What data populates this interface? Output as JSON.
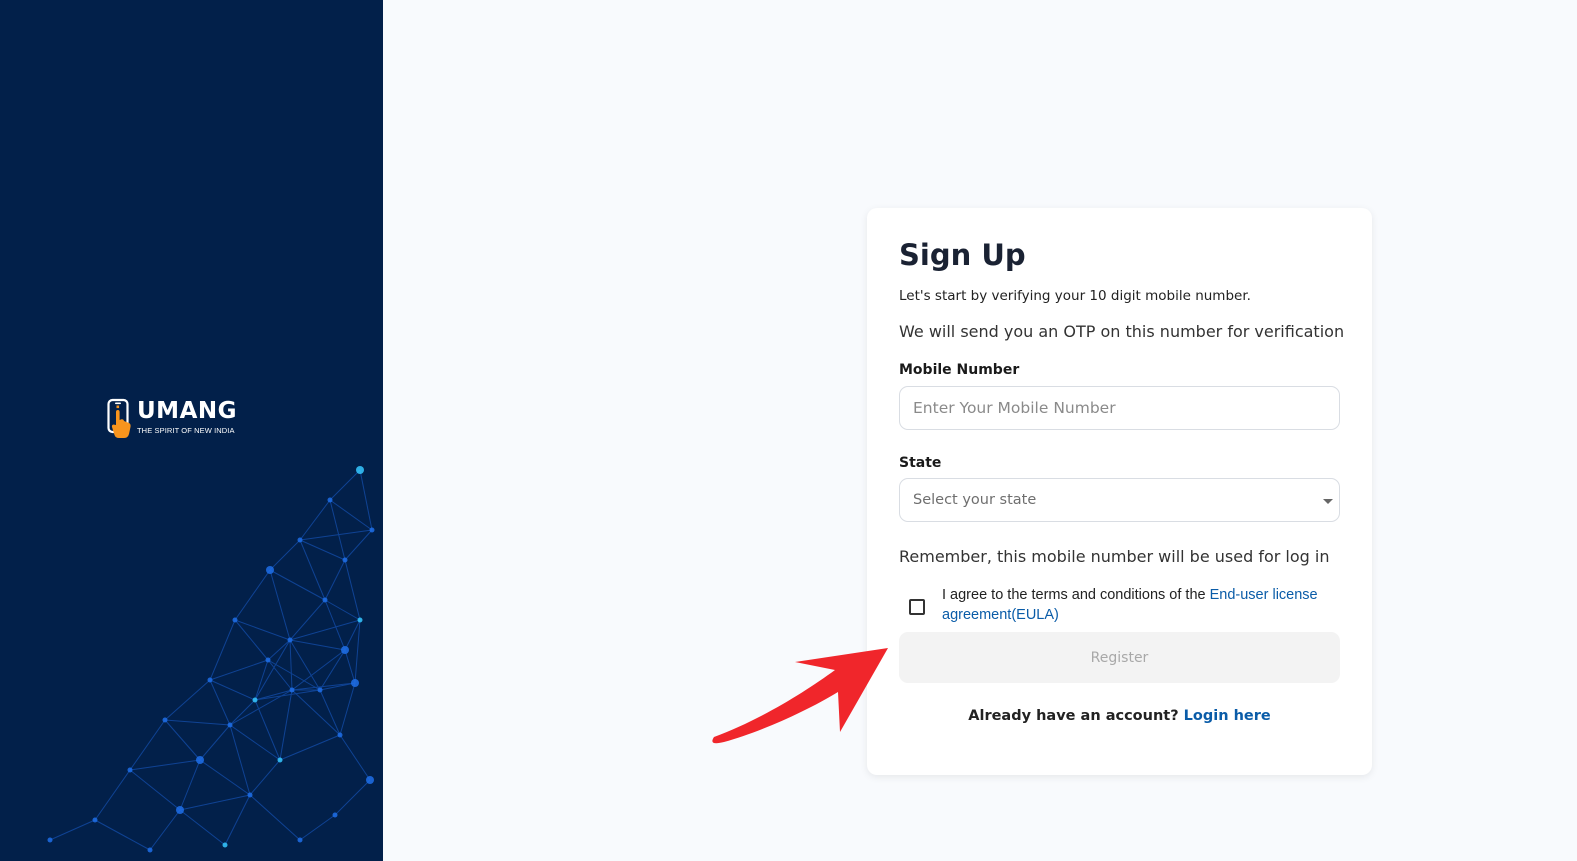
{
  "brand": {
    "name": "UMANG",
    "tagline": "THE SPIRIT OF NEW INDIA",
    "panel_color": "#02204a",
    "accent_color": "#f7941d"
  },
  "signup": {
    "title": "Sign Up",
    "subtitle_primary": "Let's start by verifying your 10 digit mobile number.",
    "subtitle_secondary": "We will send you an OTP on this number for verification",
    "mobile_label": "Mobile Number",
    "mobile_placeholder": "Enter Your Mobile Number",
    "mobile_value": "",
    "state_label": "State",
    "state_placeholder": "Select your state",
    "remember_note": "Remember, this mobile number will be used for log in",
    "terms_text": "I agree to the terms and conditions of the ",
    "terms_link": "End-user license agreement(EULA)",
    "terms_checked": false,
    "register_label": "Register",
    "register_enabled": false,
    "login_prompt": "Already have an account? ",
    "login_link": "Login here",
    "link_color": "#0a5ca8"
  },
  "annotation": {
    "arrow_color": "#f0262b",
    "arrow_target": "register-button"
  }
}
